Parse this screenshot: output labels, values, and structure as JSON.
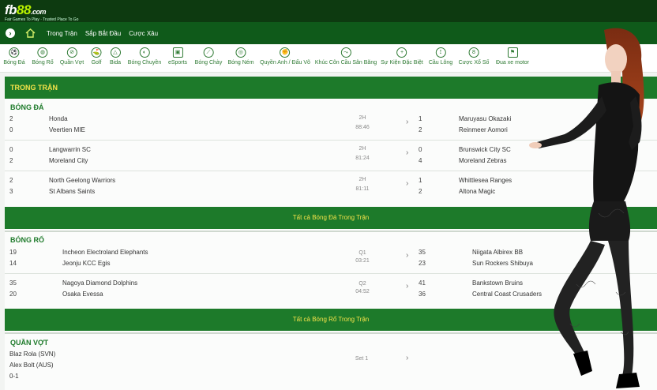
{
  "brand": {
    "name_part1": "fb",
    "name_part2": "88",
    "name_part3": ".com",
    "tagline": "Fair Games To Play · Trusted Place To Go"
  },
  "nav": {
    "items": [
      "Trong Trận",
      "Sắp Bắt Đầu",
      "Cược Xâu"
    ]
  },
  "sports": [
    {
      "label": "Bóng Đá",
      "icon": "⚽"
    },
    {
      "label": "Bóng Rổ",
      "icon": "◍"
    },
    {
      "label": "Quần Vợt",
      "icon": "⊘"
    },
    {
      "label": "Golf",
      "icon": "⛳"
    },
    {
      "label": "Bida",
      "icon": "△"
    },
    {
      "label": "Bóng Chuyền",
      "icon": "◐"
    },
    {
      "label": "eSports",
      "icon": "▣"
    },
    {
      "label": "Bóng Chày",
      "icon": "⟋"
    },
    {
      "label": "Bóng Ném",
      "icon": "◎"
    },
    {
      "label": "Quyền Anh / Đấu Võ",
      "icon": "✊"
    },
    {
      "label": "Khúc Côn Cầu Sân Băng",
      "icon": "⤳"
    },
    {
      "label": "Sự Kiện Đặc Biệt",
      "icon": "+"
    },
    {
      "label": "Cầu Lông",
      "icon": "⟟"
    },
    {
      "label": "Cược Xổ Số",
      "icon": "8"
    },
    {
      "label": "Đua xe motor",
      "icon": "⚑"
    }
  ],
  "section_title": "TRONG TRẬN",
  "football": {
    "title": "BÓNG ĐÁ",
    "matches": [
      {
        "s1": "2",
        "s2": "0",
        "t1": "Honda",
        "t2": "Veertien MIE",
        "period": "2H",
        "time": "88:46",
        "r1": "1",
        "r2": "2",
        "o1": "Maruyasu Okazaki",
        "o2": "Reinmeer Aomori"
      },
      {
        "s1": "0",
        "s2": "2",
        "t1": "Langwarrin SC",
        "t2": "Moreland City",
        "period": "2H",
        "time": "81:24",
        "r1": "0",
        "r2": "4",
        "o1": "Brunswick City SC",
        "o2": "Moreland Zebras"
      },
      {
        "s1": "2",
        "s2": "3",
        "t1": "North Geelong Warriors",
        "t2": "St Albans Saints",
        "period": "2H",
        "time": "81:11",
        "r1": "1",
        "r2": "2",
        "o1": "Whittlesea Ranges",
        "o2": "Altona Magic"
      }
    ],
    "all_label": "Tất cả Bóng Đá Trong Trận"
  },
  "basketball": {
    "title": "BÓNG RỔ",
    "matches": [
      {
        "s1": "19",
        "s2": "14",
        "t1": "Incheon Electroland Elephants",
        "t2": "Jeonju KCC Egis",
        "period": "Q1",
        "time": "03:21",
        "r1": "35",
        "r2": "23",
        "o1": "Niigata Albirex BB",
        "o2": "Sun Rockers Shibuya"
      },
      {
        "s1": "35",
        "s2": "20",
        "t1": "Nagoya Diamond Dolphins",
        "t2": "Osaka Evessa",
        "period": "Q2",
        "time": "04:52",
        "r1": "41",
        "r2": "36",
        "o1": "Bankstown Bruins",
        "o2": "Central Coast Crusaders"
      }
    ],
    "all_label": "Tất cả Bóng Rổ Trong Trận"
  },
  "tennis": {
    "title": "QUẦN VỢT",
    "p1": "Blaz Rola (SVN)",
    "p2": "Alex Bolt (AUS)",
    "score": "0-1",
    "period": "Set 1"
  },
  "colors": {
    "dark_green": "#0d3a10",
    "nav_green": "#0f5a1a",
    "section_green": "#1d7a2a",
    "yellow": "#f4e24a"
  }
}
